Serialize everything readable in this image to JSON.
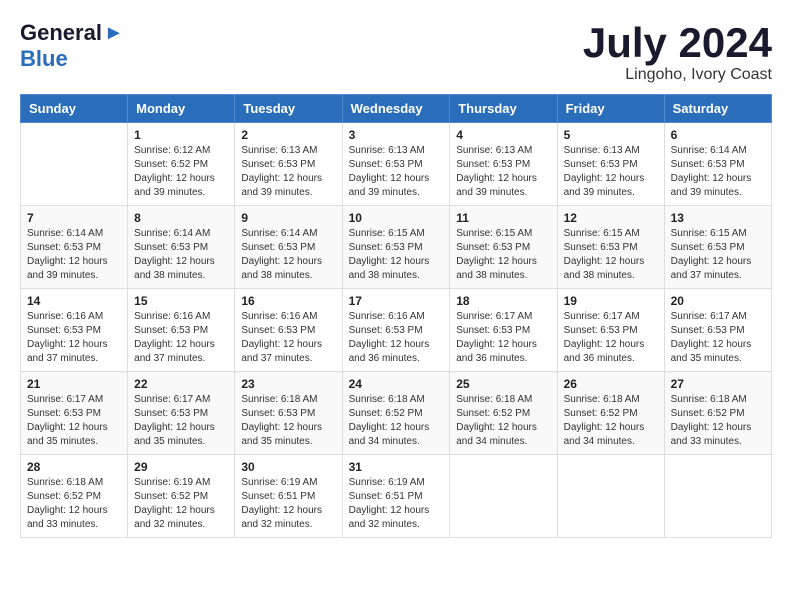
{
  "logo": {
    "general": "General",
    "blue": "Blue"
  },
  "title": "July 2024",
  "subtitle": "Lingoho, Ivory Coast",
  "weekdays": [
    "Sunday",
    "Monday",
    "Tuesday",
    "Wednesday",
    "Thursday",
    "Friday",
    "Saturday"
  ],
  "weeks": [
    [
      {
        "day": "",
        "info": ""
      },
      {
        "day": "1",
        "info": "Sunrise: 6:12 AM\nSunset: 6:52 PM\nDaylight: 12 hours\nand 39 minutes."
      },
      {
        "day": "2",
        "info": "Sunrise: 6:13 AM\nSunset: 6:53 PM\nDaylight: 12 hours\nand 39 minutes."
      },
      {
        "day": "3",
        "info": "Sunrise: 6:13 AM\nSunset: 6:53 PM\nDaylight: 12 hours\nand 39 minutes."
      },
      {
        "day": "4",
        "info": "Sunrise: 6:13 AM\nSunset: 6:53 PM\nDaylight: 12 hours\nand 39 minutes."
      },
      {
        "day": "5",
        "info": "Sunrise: 6:13 AM\nSunset: 6:53 PM\nDaylight: 12 hours\nand 39 minutes."
      },
      {
        "day": "6",
        "info": "Sunrise: 6:14 AM\nSunset: 6:53 PM\nDaylight: 12 hours\nand 39 minutes."
      }
    ],
    [
      {
        "day": "7",
        "info": "Sunrise: 6:14 AM\nSunset: 6:53 PM\nDaylight: 12 hours\nand 39 minutes."
      },
      {
        "day": "8",
        "info": "Sunrise: 6:14 AM\nSunset: 6:53 PM\nDaylight: 12 hours\nand 38 minutes."
      },
      {
        "day": "9",
        "info": "Sunrise: 6:14 AM\nSunset: 6:53 PM\nDaylight: 12 hours\nand 38 minutes."
      },
      {
        "day": "10",
        "info": "Sunrise: 6:15 AM\nSunset: 6:53 PM\nDaylight: 12 hours\nand 38 minutes."
      },
      {
        "day": "11",
        "info": "Sunrise: 6:15 AM\nSunset: 6:53 PM\nDaylight: 12 hours\nand 38 minutes."
      },
      {
        "day": "12",
        "info": "Sunrise: 6:15 AM\nSunset: 6:53 PM\nDaylight: 12 hours\nand 38 minutes."
      },
      {
        "day": "13",
        "info": "Sunrise: 6:15 AM\nSunset: 6:53 PM\nDaylight: 12 hours\nand 37 minutes."
      }
    ],
    [
      {
        "day": "14",
        "info": "Sunrise: 6:16 AM\nSunset: 6:53 PM\nDaylight: 12 hours\nand 37 minutes."
      },
      {
        "day": "15",
        "info": "Sunrise: 6:16 AM\nSunset: 6:53 PM\nDaylight: 12 hours\nand 37 minutes."
      },
      {
        "day": "16",
        "info": "Sunrise: 6:16 AM\nSunset: 6:53 PM\nDaylight: 12 hours\nand 37 minutes."
      },
      {
        "day": "17",
        "info": "Sunrise: 6:16 AM\nSunset: 6:53 PM\nDaylight: 12 hours\nand 36 minutes."
      },
      {
        "day": "18",
        "info": "Sunrise: 6:17 AM\nSunset: 6:53 PM\nDaylight: 12 hours\nand 36 minutes."
      },
      {
        "day": "19",
        "info": "Sunrise: 6:17 AM\nSunset: 6:53 PM\nDaylight: 12 hours\nand 36 minutes."
      },
      {
        "day": "20",
        "info": "Sunrise: 6:17 AM\nSunset: 6:53 PM\nDaylight: 12 hours\nand 35 minutes."
      }
    ],
    [
      {
        "day": "21",
        "info": "Sunrise: 6:17 AM\nSunset: 6:53 PM\nDaylight: 12 hours\nand 35 minutes."
      },
      {
        "day": "22",
        "info": "Sunrise: 6:17 AM\nSunset: 6:53 PM\nDaylight: 12 hours\nand 35 minutes."
      },
      {
        "day": "23",
        "info": "Sunrise: 6:18 AM\nSunset: 6:53 PM\nDaylight: 12 hours\nand 35 minutes."
      },
      {
        "day": "24",
        "info": "Sunrise: 6:18 AM\nSunset: 6:52 PM\nDaylight: 12 hours\nand 34 minutes."
      },
      {
        "day": "25",
        "info": "Sunrise: 6:18 AM\nSunset: 6:52 PM\nDaylight: 12 hours\nand 34 minutes."
      },
      {
        "day": "26",
        "info": "Sunrise: 6:18 AM\nSunset: 6:52 PM\nDaylight: 12 hours\nand 34 minutes."
      },
      {
        "day": "27",
        "info": "Sunrise: 6:18 AM\nSunset: 6:52 PM\nDaylight: 12 hours\nand 33 minutes."
      }
    ],
    [
      {
        "day": "28",
        "info": "Sunrise: 6:18 AM\nSunset: 6:52 PM\nDaylight: 12 hours\nand 33 minutes."
      },
      {
        "day": "29",
        "info": "Sunrise: 6:19 AM\nSunset: 6:52 PM\nDaylight: 12 hours\nand 32 minutes."
      },
      {
        "day": "30",
        "info": "Sunrise: 6:19 AM\nSunset: 6:51 PM\nDaylight: 12 hours\nand 32 minutes."
      },
      {
        "day": "31",
        "info": "Sunrise: 6:19 AM\nSunset: 6:51 PM\nDaylight: 12 hours\nand 32 minutes."
      },
      {
        "day": "",
        "info": ""
      },
      {
        "day": "",
        "info": ""
      },
      {
        "day": "",
        "info": ""
      }
    ]
  ]
}
